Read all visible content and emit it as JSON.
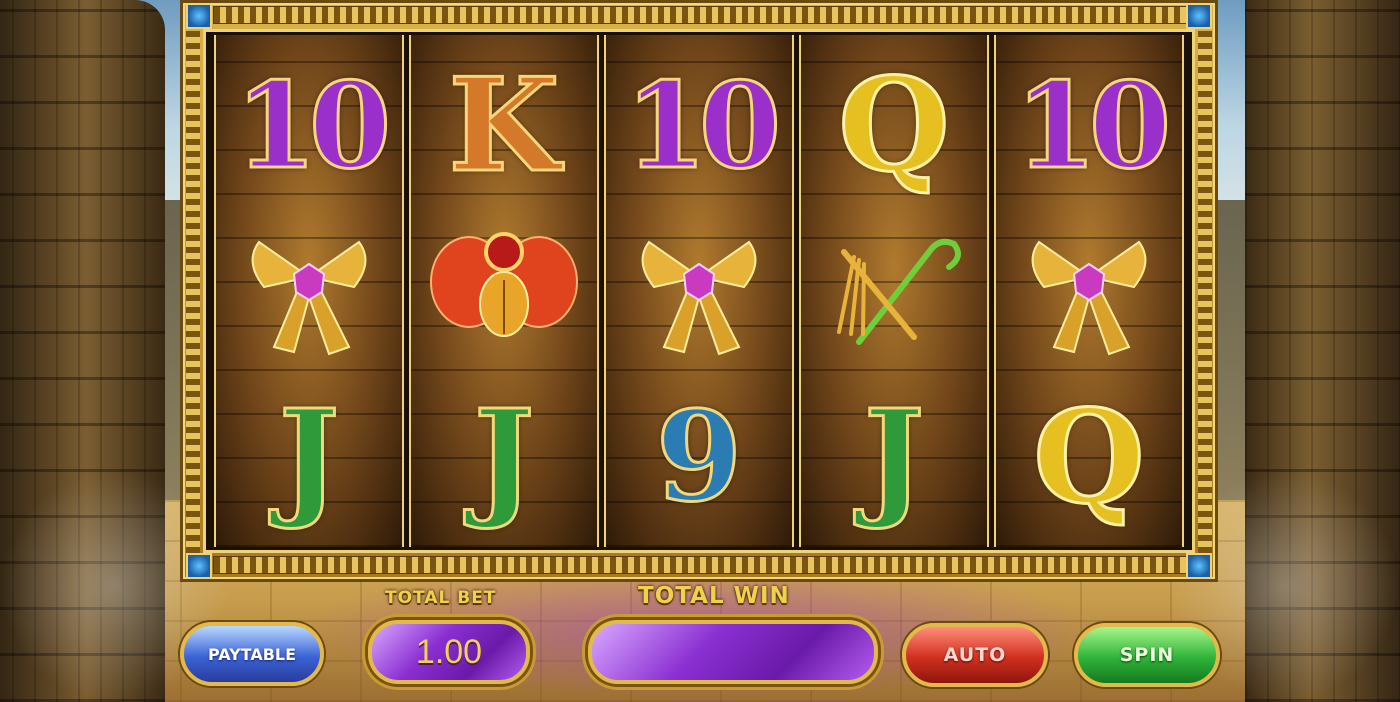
{
  "reels": [
    {
      "symbols": [
        "10",
        "ankh-bow",
        "J"
      ],
      "classes": [
        "ten",
        "pic",
        "j"
      ]
    },
    {
      "symbols": [
        "K",
        "scarab",
        "J"
      ],
      "classes": [
        "k",
        "pic",
        "j"
      ]
    },
    {
      "symbols": [
        "10",
        "ankh-bow",
        "9"
      ],
      "classes": [
        "ten",
        "pic",
        "nine"
      ]
    },
    {
      "symbols": [
        "Q",
        "crook-flail",
        "J"
      ],
      "classes": [
        "q",
        "pic",
        "j"
      ]
    },
    {
      "symbols": [
        "10",
        "ankh-bow",
        "Q"
      ],
      "classes": [
        "ten",
        "pic",
        "q"
      ]
    }
  ],
  "controls": {
    "paytable_label": "PAYTABLE",
    "total_bet_label": "TOTAL BET",
    "total_bet_value": "1.00",
    "total_win_label": "TOTAL WIN",
    "total_win_value": "",
    "auto_label": "AUTO",
    "spin_label": "SPIN"
  },
  "colors": {
    "gold": "#e2b94a",
    "purple": "#8a2fd1",
    "spin_green": "#2fb43a",
    "auto_red": "#d0301f",
    "paytable_blue": "#3b64d6"
  }
}
